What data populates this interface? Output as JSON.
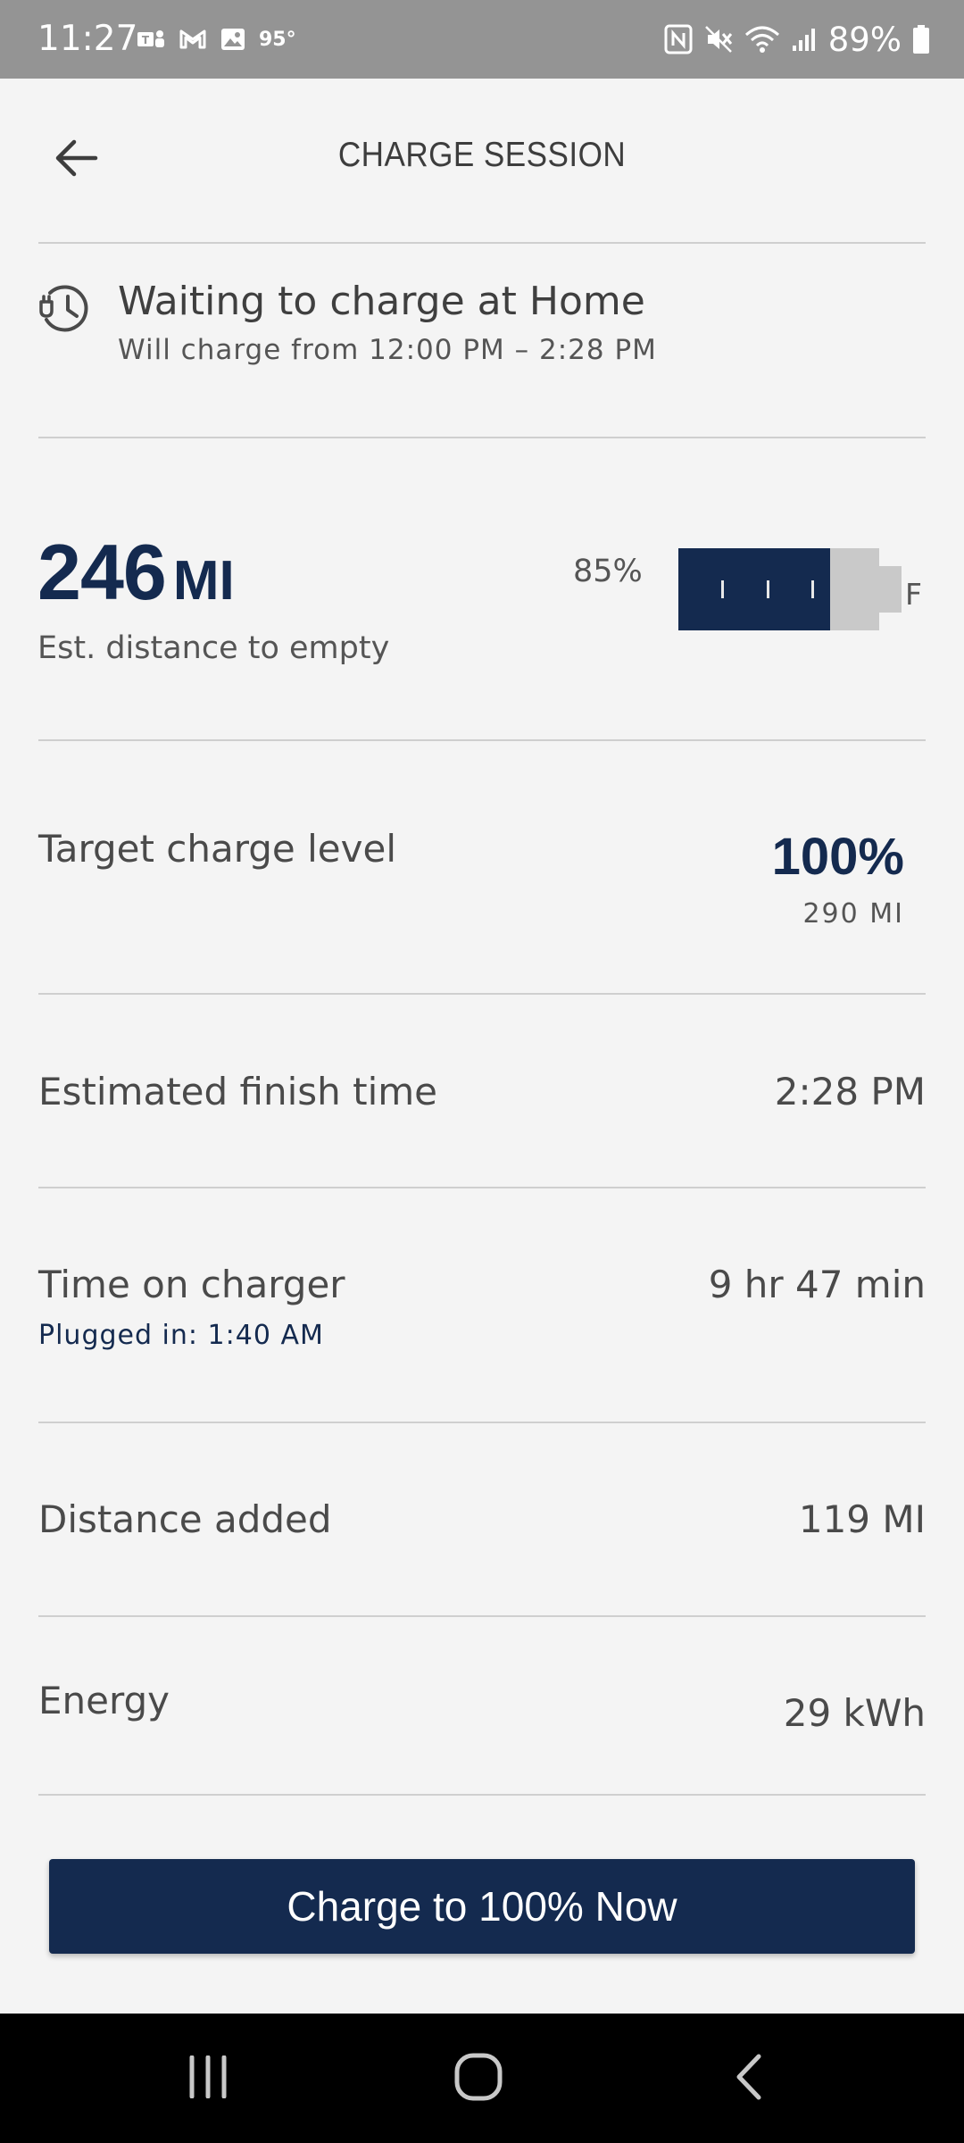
{
  "status_bar": {
    "time": "11:27",
    "temperature": "95°",
    "battery": "89%",
    "left_icons": [
      "teams-icon",
      "gmail-icon",
      "gallery-icon"
    ],
    "right_icons": [
      "nfc-icon",
      "mute-icon",
      "wifi-icon",
      "signal-icon",
      "battery-icon"
    ]
  },
  "header": {
    "title": "CHARGE SESSION"
  },
  "charge_status": {
    "title": "Waiting to charge at Home",
    "subtitle": "Will charge from 12:00 PM – 2:28 PM"
  },
  "range": {
    "distance": "246",
    "unit": "MI",
    "caption": "Est. distance to empty",
    "battery_percent_label": "85%",
    "battery_level": 0.85,
    "full_label": "F"
  },
  "details": {
    "target": {
      "label": "Target charge level",
      "value": "100%",
      "sub": "290 MI"
    },
    "finish": {
      "label": "Estimated finish time",
      "value": "2:28 PM"
    },
    "time_on_charger": {
      "label": "Time on charger",
      "value": "9 hr 47 min",
      "sub": "Plugged in: 1:40 AM"
    },
    "distance_added": {
      "label": "Distance added",
      "value": "119 MI"
    },
    "energy": {
      "label": "Energy",
      "value": "29 kWh"
    }
  },
  "cta": {
    "label": "Charge to 100% Now"
  },
  "colors": {
    "primary": "#142a4f",
    "background": "#f4f4f4",
    "divider": "#cfcfcf",
    "status_bar": "#949494"
  }
}
